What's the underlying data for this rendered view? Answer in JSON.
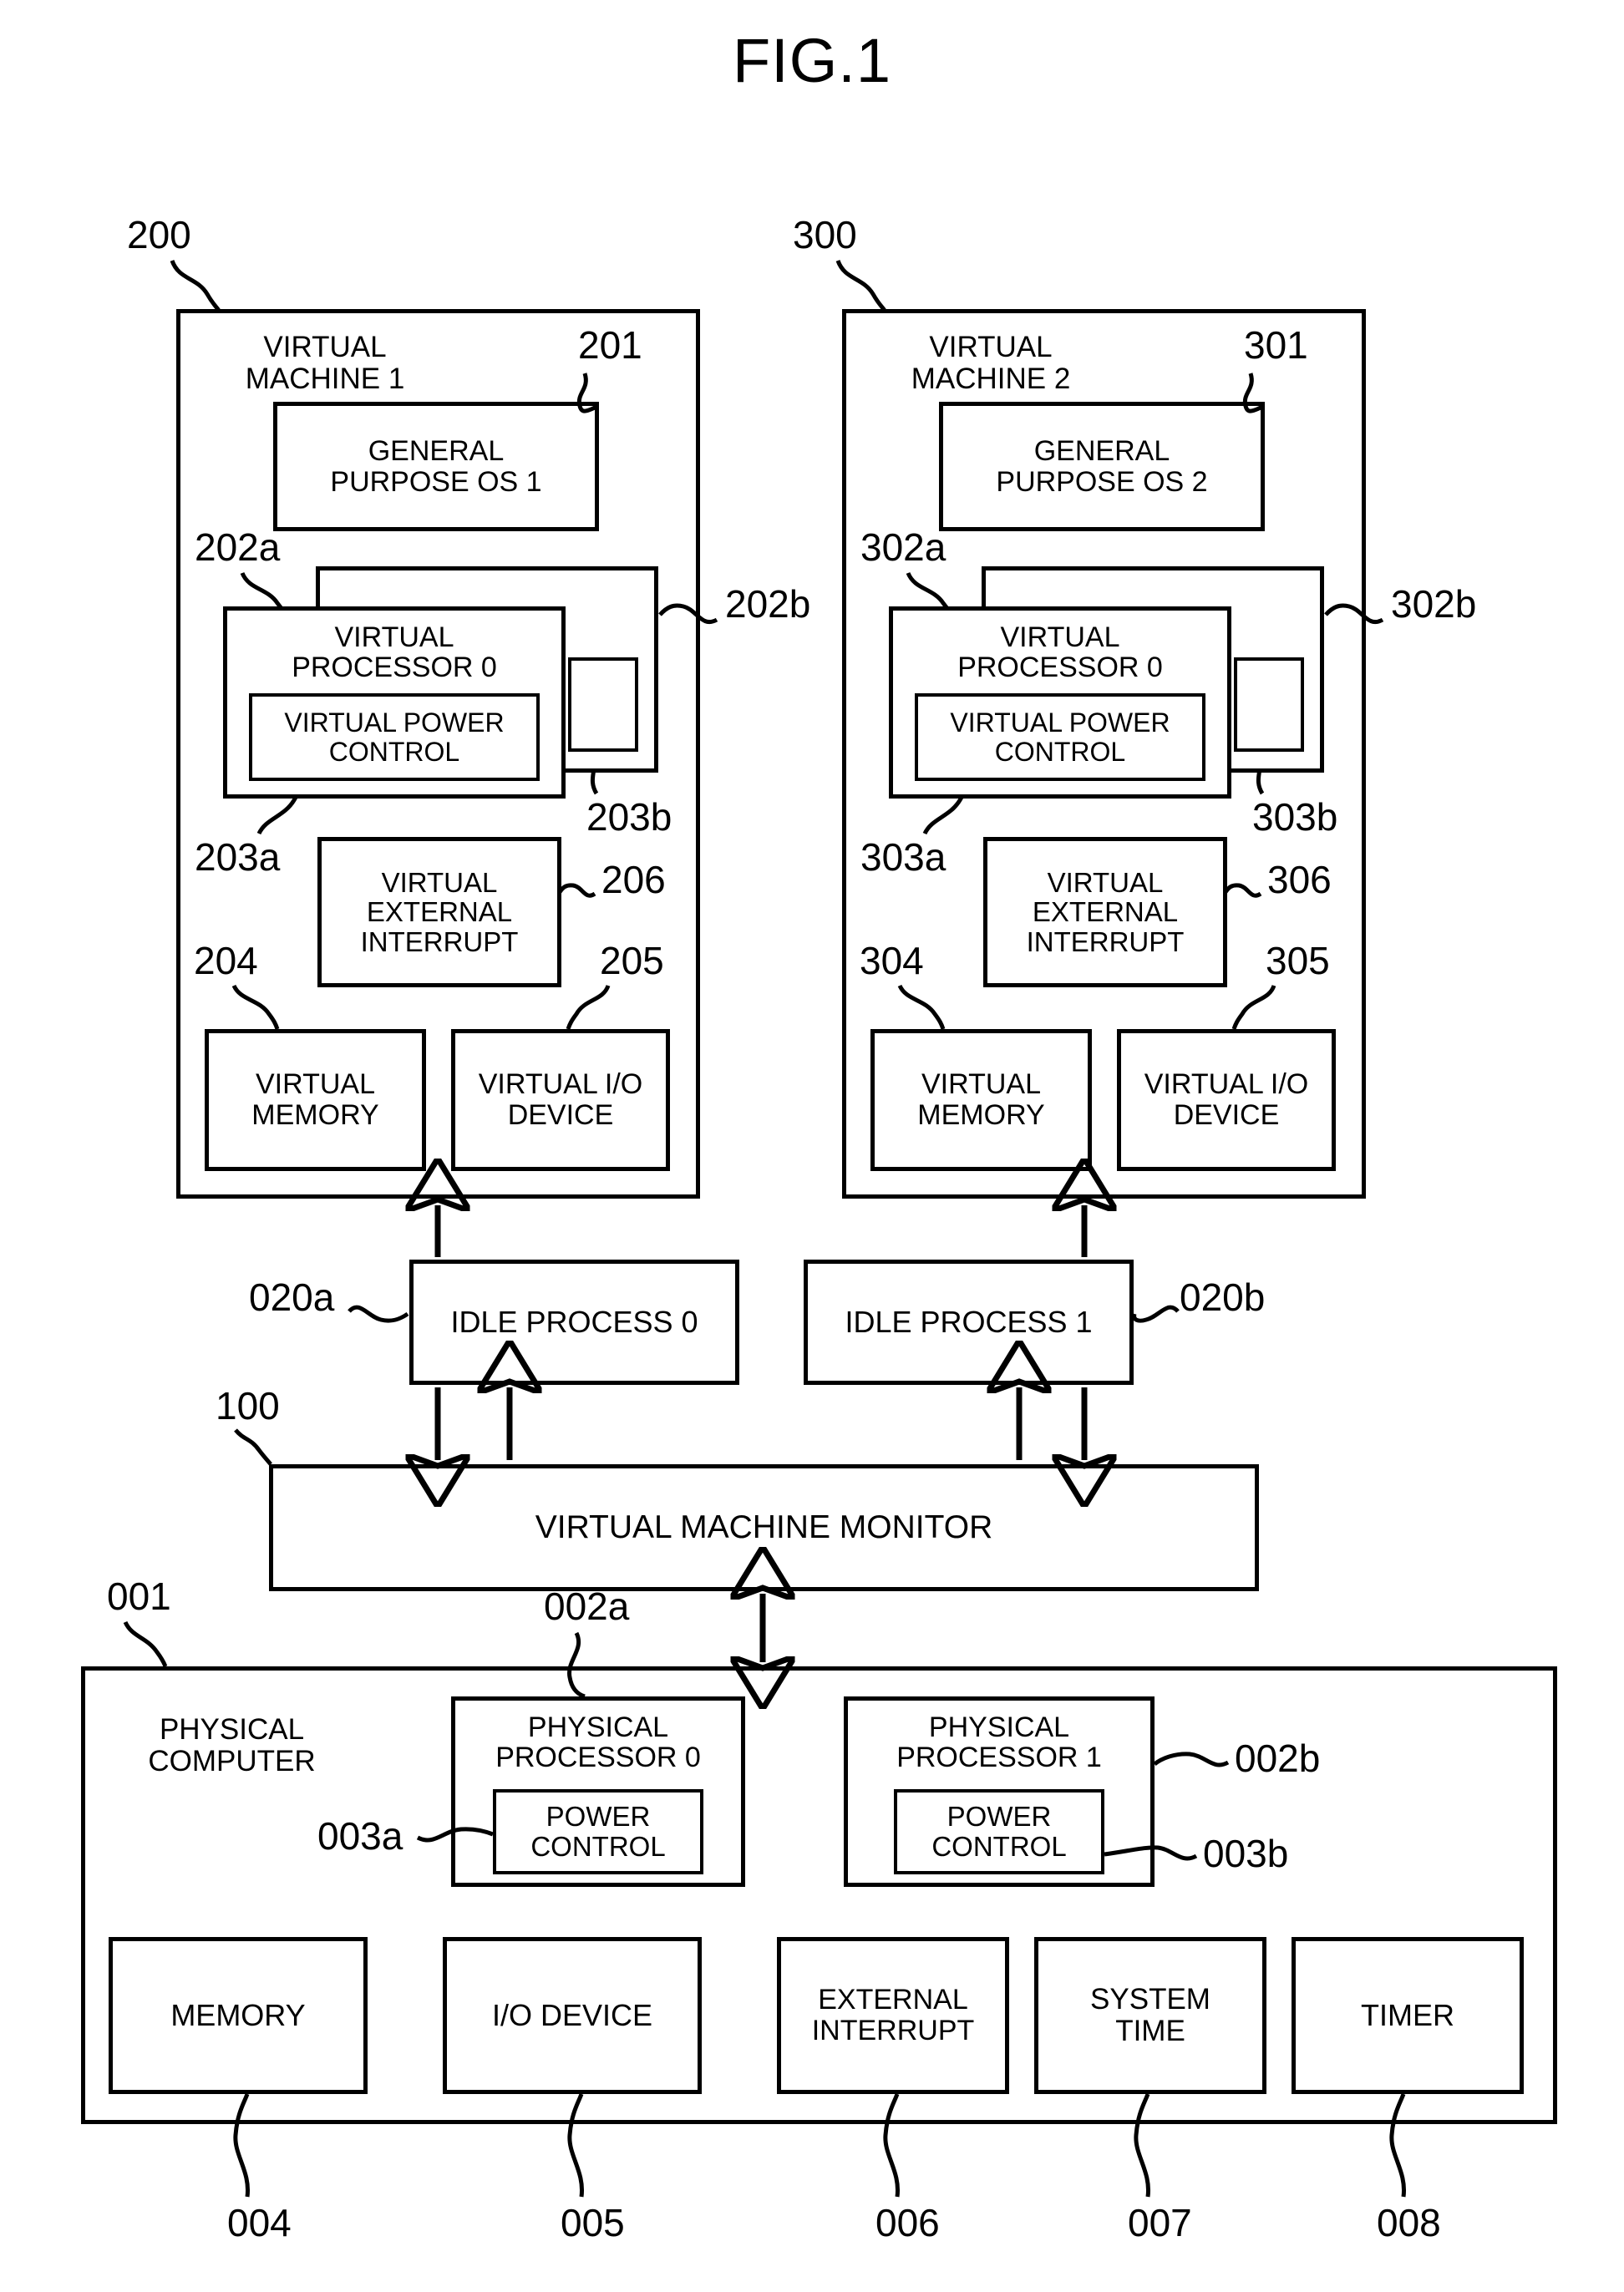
{
  "figure": {
    "title": "FIG.1"
  },
  "vm1": {
    "ref": "200",
    "title": "VIRTUAL\nMACHINE 1",
    "os": {
      "ref": "201",
      "label": "GENERAL\nPURPOSE OS 1"
    },
    "vproc_front": {
      "ref": "202a",
      "label": "VIRTUAL\nPROCESSOR 0"
    },
    "vproc_back": {
      "ref": "202b",
      "label": ""
    },
    "vpower_front": {
      "ref": "203a",
      "label": "VIRTUAL POWER\nCONTROL"
    },
    "vpower_back": {
      "ref": "203b",
      "label": ""
    },
    "vinterrupt": {
      "ref": "206",
      "label": "VIRTUAL\nEXTERNAL\nINTERRUPT"
    },
    "vmemory": {
      "ref": "204",
      "label": "VIRTUAL\nMEMORY"
    },
    "vio": {
      "ref": "205",
      "label": "VIRTUAL I/O\nDEVICE"
    }
  },
  "vm2": {
    "ref": "300",
    "title": "VIRTUAL\nMACHINE 2",
    "os": {
      "ref": "301",
      "label": "GENERAL\nPURPOSE OS 2"
    },
    "vproc_front": {
      "ref": "302a",
      "label": "VIRTUAL\nPROCESSOR 0"
    },
    "vproc_back": {
      "ref": "302b",
      "label": ""
    },
    "vpower_front": {
      "ref": "303a",
      "label": "VIRTUAL POWER\nCONTROL"
    },
    "vpower_back": {
      "ref": "303b",
      "label": ""
    },
    "vinterrupt": {
      "ref": "306",
      "label": "VIRTUAL\nEXTERNAL\nINTERRUPT"
    },
    "vmemory": {
      "ref": "304",
      "label": "VIRTUAL\nMEMORY"
    },
    "vio": {
      "ref": "305",
      "label": "VIRTUAL I/O\nDEVICE"
    }
  },
  "idle": {
    "process0": {
      "ref": "020a",
      "label": "IDLE PROCESS 0"
    },
    "process1": {
      "ref": "020b",
      "label": "IDLE PROCESS 1"
    }
  },
  "vmm": {
    "ref": "100",
    "label": "VIRTUAL MACHINE MONITOR"
  },
  "physical": {
    "ref": "001",
    "title": "PHYSICAL\nCOMPUTER",
    "processor0": {
      "ref": "002a",
      "label": "PHYSICAL\nPROCESSOR 0"
    },
    "processor1": {
      "ref": "002b",
      "label": "PHYSICAL\nPROCESSOR 1"
    },
    "power0": {
      "ref": "003a",
      "label": "POWER\nCONTROL"
    },
    "power1": {
      "ref": "003b",
      "label": "POWER\nCONTROL"
    },
    "memory": {
      "ref": "004",
      "label": "MEMORY"
    },
    "io_device": {
      "ref": "005",
      "label": "I/O DEVICE"
    },
    "external_interrupt": {
      "ref": "006",
      "label": "EXTERNAL\nINTERRUPT"
    },
    "system_time": {
      "ref": "007",
      "label": "SYSTEM\nTIME"
    },
    "timer": {
      "ref": "008",
      "label": "TIMER"
    }
  },
  "colors": {
    "ink": "#000000",
    "paper": "#ffffff"
  }
}
